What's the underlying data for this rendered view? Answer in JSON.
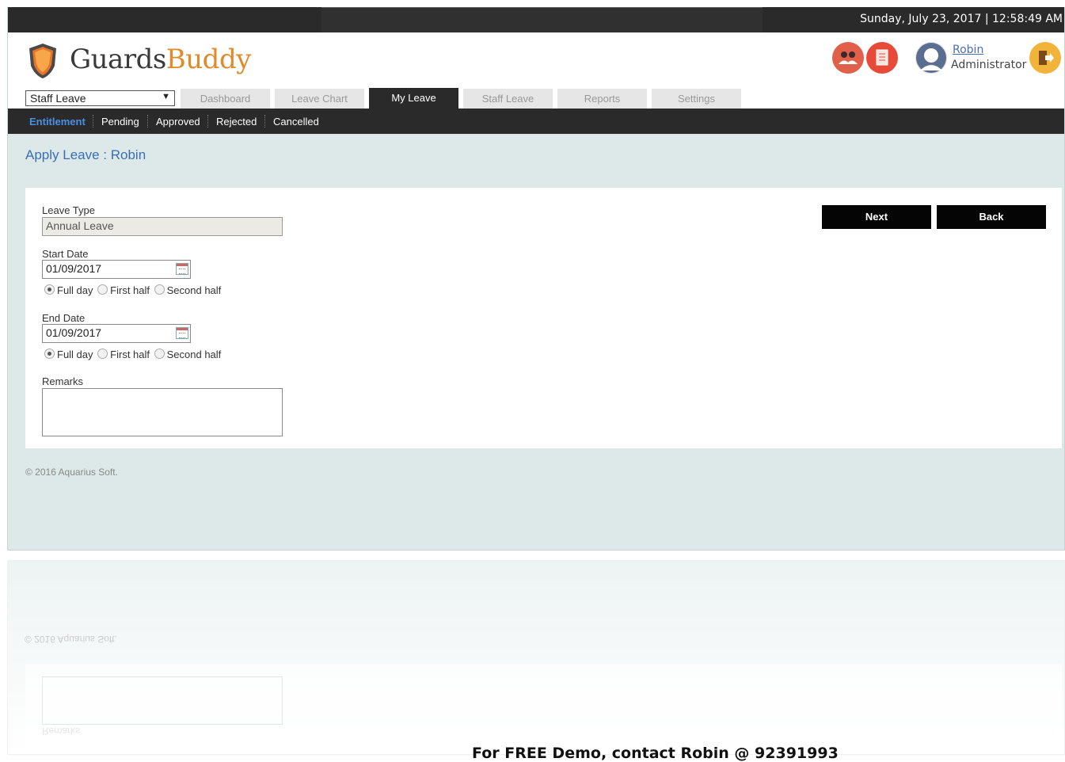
{
  "topbar": {
    "datetime": "Sunday, July 23, 2017   |   12:58:49 AM"
  },
  "brand": {
    "part1": "Guards",
    "part2": "Buddy"
  },
  "user": {
    "name": "Robin",
    "role": "Administrator"
  },
  "icons": {
    "staff": "staff-icon",
    "document": "document-icon",
    "avatar": "avatar-icon",
    "logout": "logout-icon",
    "calendar": "calendar-icon"
  },
  "module_select": {
    "value": "Staff Leave"
  },
  "tabs": [
    {
      "label": "Dashboard"
    },
    {
      "label": "Leave Chart"
    },
    {
      "label": "My Leave",
      "active": true
    },
    {
      "label": "Staff Leave"
    },
    {
      "label": "Reports"
    },
    {
      "label": "Settings"
    }
  ],
  "subnav": [
    {
      "label": "Entitlement",
      "active": true
    },
    {
      "label": "Pending"
    },
    {
      "label": "Approved"
    },
    {
      "label": "Rejected"
    },
    {
      "label": "Cancelled"
    }
  ],
  "page": {
    "title": "Apply Leave : Robin"
  },
  "form": {
    "leave_type_label": "Leave Type",
    "leave_type_value": "Annual Leave",
    "start_date_label": "Start Date",
    "start_date_value": "01/09/2017",
    "end_date_label": "End Date",
    "end_date_value": "01/09/2017",
    "options": {
      "full_day": "Full day",
      "first_half": "First half",
      "second_half": "Second half"
    },
    "start_selected": "Full day",
    "end_selected": "Full day",
    "remarks_label": "Remarks",
    "remarks_value": ""
  },
  "buttons": {
    "next": "Next",
    "back": "Back"
  },
  "footer": {
    "copyright": "© 2016 Aquarius Soft."
  },
  "promo": {
    "text": "For FREE Demo, contact Robin @ 92391993"
  },
  "colors": {
    "accent_blue": "#3a6fb5",
    "topbar": "#2a2a2a",
    "content_bg": "#dde9e9",
    "button": "#050505"
  }
}
